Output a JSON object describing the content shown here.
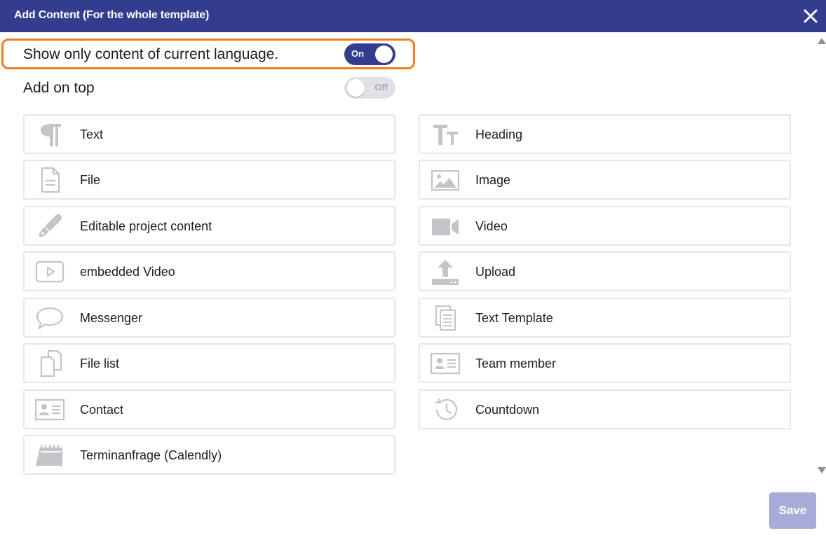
{
  "dialog": {
    "title": "Add Content (For the whole template)",
    "close_icon": "close-icon"
  },
  "toggles": {
    "language": {
      "label": "Show only content of current language.",
      "state": "On"
    },
    "on_top": {
      "label": "Add on top",
      "state": "Off"
    }
  },
  "items_left": [
    {
      "label": "Text",
      "icon": "paragraph-icon"
    },
    {
      "label": "File",
      "icon": "file-icon"
    },
    {
      "label": "Editable project content",
      "icon": "pen-icon"
    },
    {
      "label": "embedded Video",
      "icon": "play-box-icon"
    },
    {
      "label": "Messenger",
      "icon": "speech-bubble-icon"
    },
    {
      "label": "File list",
      "icon": "files-icon"
    },
    {
      "label": "Contact",
      "icon": "contact-card-icon"
    },
    {
      "label": "Terminanfrage (Calendly)",
      "icon": "calendar-icon"
    }
  ],
  "items_right": [
    {
      "label": "Heading",
      "icon": "text-size-icon"
    },
    {
      "label": "Image",
      "icon": "image-icon"
    },
    {
      "label": "Video",
      "icon": "video-camera-icon"
    },
    {
      "label": "Upload",
      "icon": "upload-icon"
    },
    {
      "label": "Text Template",
      "icon": "documents-icon"
    },
    {
      "label": "Team member",
      "icon": "id-card-icon"
    },
    {
      "label": "Countdown",
      "icon": "history-icon"
    }
  ],
  "footer": {
    "save_label": "Save"
  },
  "colors": {
    "header": "#343c8f",
    "highlight": "#f27c1c",
    "save_disabled": "#a7abd7",
    "icon_gray": "#c4c4c9"
  }
}
